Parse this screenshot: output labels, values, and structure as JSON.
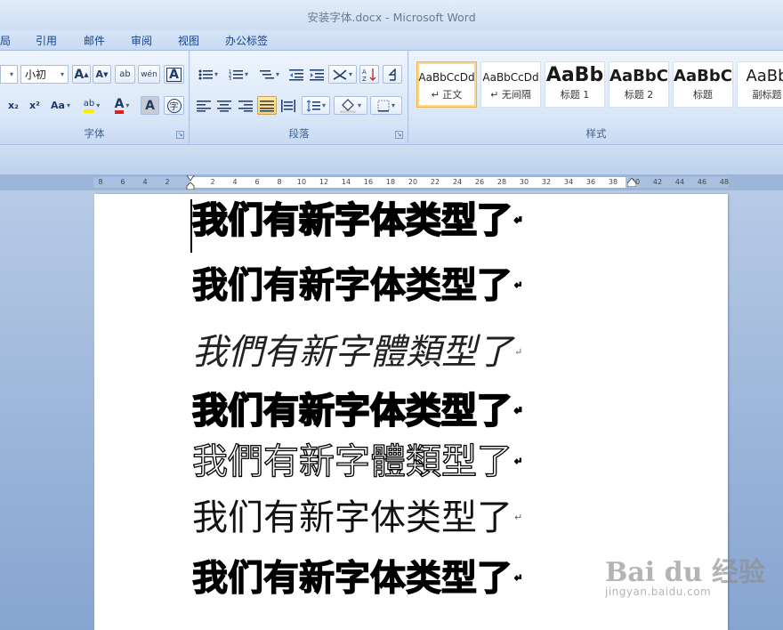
{
  "window": {
    "title": "安装字体.docx - Microsoft Word"
  },
  "ribbon_tabs": [
    "局",
    "引用",
    "邮件",
    "审阅",
    "视图",
    "办公标签"
  ],
  "font_group": {
    "label": "字体",
    "font_size_value": "小初",
    "grow_font": "A",
    "shrink_font": "A",
    "clear_format": "ab",
    "phonetic": "wén",
    "char_border": "A",
    "subscript": "x₂",
    "superscript": "x²",
    "change_case": "Aa",
    "highlight": "ab",
    "font_color": "A",
    "char_shading": "A",
    "enclose": "字"
  },
  "paragraph_group": {
    "label": "段落"
  },
  "styles_group": {
    "label": "样式",
    "tiles": [
      {
        "sample": "AaBbCcDd",
        "name": "↵ 正文"
      },
      {
        "sample": "AaBbCcDd",
        "name": "↵ 无间隔"
      },
      {
        "sample": "AaBb",
        "name": "标题 1"
      },
      {
        "sample": "AaBbC",
        "name": "标题 2"
      },
      {
        "sample": "AaBbC",
        "name": "标题"
      },
      {
        "sample": "AaBb",
        "name": "副标题"
      }
    ]
  },
  "ruler": {
    "left_ticks": [
      "8",
      "6",
      "4",
      "2"
    ],
    "right_ticks": [
      "2",
      "4",
      "6",
      "8",
      "10",
      "12",
      "14",
      "16",
      "18",
      "20",
      "22",
      "24",
      "26",
      "28",
      "30",
      "32",
      "34",
      "36",
      "38",
      "40",
      "42",
      "44",
      "46",
      "48"
    ]
  },
  "document": {
    "paragraph_mark": "↵",
    "lines": [
      "我们有新字体类型了",
      "我们有新字体类型了",
      "我們有新字體類型了",
      "我们有新字体类型了",
      "我們有新字體類型了",
      "我们有新字体类型了",
      "我们有新字体类型了"
    ]
  },
  "watermark": {
    "logo": "Bai du 经验",
    "url": "jingyan.baidu.com"
  }
}
